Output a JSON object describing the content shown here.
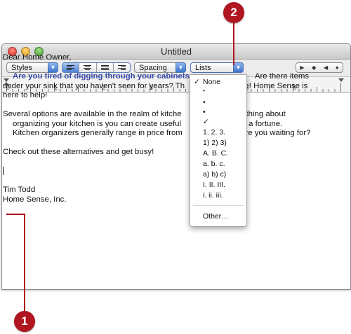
{
  "window": {
    "title": "Untitled"
  },
  "toolbar": {
    "styles_label": "Styles",
    "spacing_label": "Spacing",
    "lists_label": "Lists",
    "alignment": [
      "left",
      "center",
      "justify",
      "right"
    ],
    "alignment_selected": "left"
  },
  "ruler": {
    "numbers": [
      "0",
      "1",
      "2",
      "3",
      "4",
      "5",
      "6"
    ]
  },
  "document": {
    "greeting": "Dear Home Owner,",
    "p1_highlight": "Are you tired of digging through your cabinets",
    "p1_rest": "Are there items",
    "p1_line2": "under your sink that you haven't seen for years? Th",
    "p1_line2b": "organize! Home Sense is",
    "p1_line3": "here to help!",
    "p2_line1": "Several options are available in the realm of kitche",
    "p2_line1b": "The great thing about",
    "p2_line2": "organizing your kitchen is you can create useful",
    "p2_line2b": "investing a fortune.",
    "p2_line3": "Kitchen organizers generally range in price from",
    "p2_line3b": "what are you waiting for?",
    "p3": "Check out these alternatives and get busy!",
    "sig_name": "Tim Todd",
    "sig_company": "Home Sense, Inc."
  },
  "lists_menu": {
    "items": [
      {
        "label": "None",
        "checked": true
      },
      {
        "label": "•",
        "checked": false
      },
      {
        "label": "•",
        "checked": false
      },
      {
        "label": "•",
        "checked": false
      },
      {
        "label": "✓",
        "checked": false
      },
      {
        "label": "1.  2.  3.",
        "checked": false
      },
      {
        "label": "1)  2)  3)",
        "checked": false
      },
      {
        "label": "A.  B.  C.",
        "checked": false
      },
      {
        "label": "a.  b.  c.",
        "checked": false
      },
      {
        "label": "a)  b)  c)",
        "checked": false
      },
      {
        "label": "I.  II.  III.",
        "checked": false
      },
      {
        "label": "i.  ii.  iii.",
        "checked": false
      }
    ],
    "other_label": "Other…"
  },
  "callouts": {
    "one": "1",
    "two": "2"
  },
  "colors": {
    "callout": "#b0161f",
    "accent": "#3d76d0",
    "highlight_text": "#3a4aa8"
  }
}
